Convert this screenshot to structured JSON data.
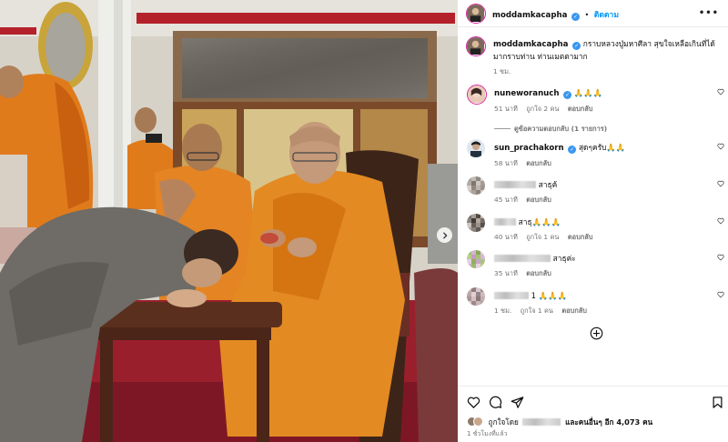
{
  "post": {
    "author": "moddamkacapha",
    "follow_label": "ติดตาม",
    "more_label": "•••"
  },
  "caption": {
    "username": "moddamkacapha",
    "text": "กราบหลวงปู่มหาศีลา สุขใจเหลือเกินที่ได้มากราบท่าน ท่านเมตตามาก",
    "time": "1 ชม."
  },
  "comments": [
    {
      "username": "nuneworanuch",
      "verified": true,
      "text": "🙏🙏🙏",
      "time": "51 นาที",
      "likes": "ถูกใจ 2 คน",
      "reply_label": "ตอบกลับ",
      "view_replies": "ดูข้อความตอบกลับ (1 รายการ)"
    },
    {
      "username": "sun_prachakorn",
      "verified": true,
      "text": "สุดๆครับ🙏🙏",
      "time": "58 นาที",
      "reply_label": "ตอบกลับ"
    },
    {
      "username": "",
      "text": "สาธุค้",
      "time": "45 นาที",
      "reply_label": "ตอบกลับ"
    },
    {
      "username": "",
      "text": "สาธุ🙏🙏🙏",
      "time": "40 นาที",
      "likes": "ถูกใจ 1 คน",
      "reply_label": "ตอบกลับ"
    },
    {
      "username": "",
      "text": "สาธุค่ะ",
      "time": "35 นาที",
      "reply_label": "ตอบกลับ"
    },
    {
      "username": "",
      "text": "1 🙏🙏🙏",
      "time": "1 ชม.",
      "likes": "ถูกใจ 1 คน",
      "reply_label": "ตอบกลับ"
    }
  ],
  "footer": {
    "liked_by_prefix": "ถูกใจโดย",
    "liked_by_suffix": "และคนอื่นๆ อีก 4,073 คน",
    "post_time": "1 ชั่วโมงที่แล้ว"
  },
  "icons": {
    "heart": "heart-icon",
    "comment": "comment-icon",
    "share": "share-icon",
    "save": "bookmark-icon",
    "add": "plus-circle-icon",
    "next": "chevron-right-icon"
  },
  "colors": {
    "link_blue": "#0095f6",
    "verified_blue": "#3897f0",
    "muted": "#737373"
  }
}
